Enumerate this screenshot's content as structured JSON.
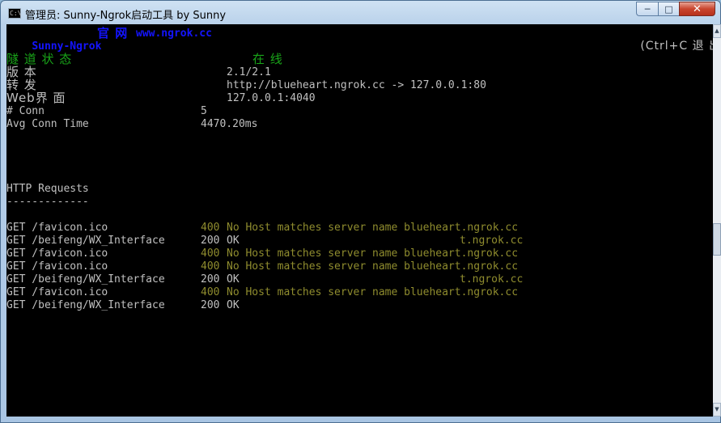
{
  "window": {
    "title": "管理员: Sunny-Ngrok启动工具 by Sunny",
    "minimize": "─",
    "maximize": "□",
    "close": "✕"
  },
  "console": {
    "header_left": {
      "brand": "Sunny-Ngrok",
      "official": "官 网",
      "url": "www.ngrok.cc"
    },
    "exit_hint": "(Ctrl+C 退 出 )",
    "status": {
      "label": "隧 道 状 态",
      "value": "在 线"
    },
    "version": {
      "label": "版 本",
      "value": "2.1/2.1"
    },
    "forward": {
      "label": "转 发",
      "value": "http://blueheart.ngrok.cc -> 127.0.0.1:80"
    },
    "web": {
      "label": "Web界 面",
      "value": "127.0.0.1:4040"
    },
    "conn": {
      "label": "# Conn",
      "value": "5"
    },
    "avg": {
      "label": "Avg Conn Time",
      "value": "4470.20ms"
    },
    "http_title": "HTTP Requests",
    "http_rule": "-------------",
    "requests": [
      {
        "req": "GET /favicon.ico",
        "code": "400",
        "message": "No Host matches server name blueheart.ngrok.cc",
        "error": true
      },
      {
        "req": "GET /beifeng/WX_Interface",
        "code": "200",
        "message": "OK",
        "tail": "t.ngrok.cc",
        "error": false
      },
      {
        "req": "GET /favicon.ico",
        "code": "400",
        "message": "No Host matches server name blueheart.ngrok.cc",
        "error": true
      },
      {
        "req": "GET /favicon.ico",
        "code": "400",
        "message": "No Host matches server name blueheart.ngrok.cc",
        "error": true
      },
      {
        "req": "GET /beifeng/WX_Interface",
        "code": "200",
        "message": "OK",
        "tail": "t.ngrok.cc",
        "error": false
      },
      {
        "req": "GET /favicon.ico",
        "code": "400",
        "message": "No Host matches server name blueheart.ngrok.cc",
        "error": true
      },
      {
        "req": "GET /beifeng/WX_Interface",
        "code": "200",
        "message": "OK",
        "tail": "",
        "error": false
      }
    ]
  },
  "colors": {
    "brand_blue": "#1414ff",
    "status_green": "#19a519",
    "error_yellow": "#8f8c2e",
    "console_gray": "#c0c0c0",
    "console_bg": "#000000"
  }
}
